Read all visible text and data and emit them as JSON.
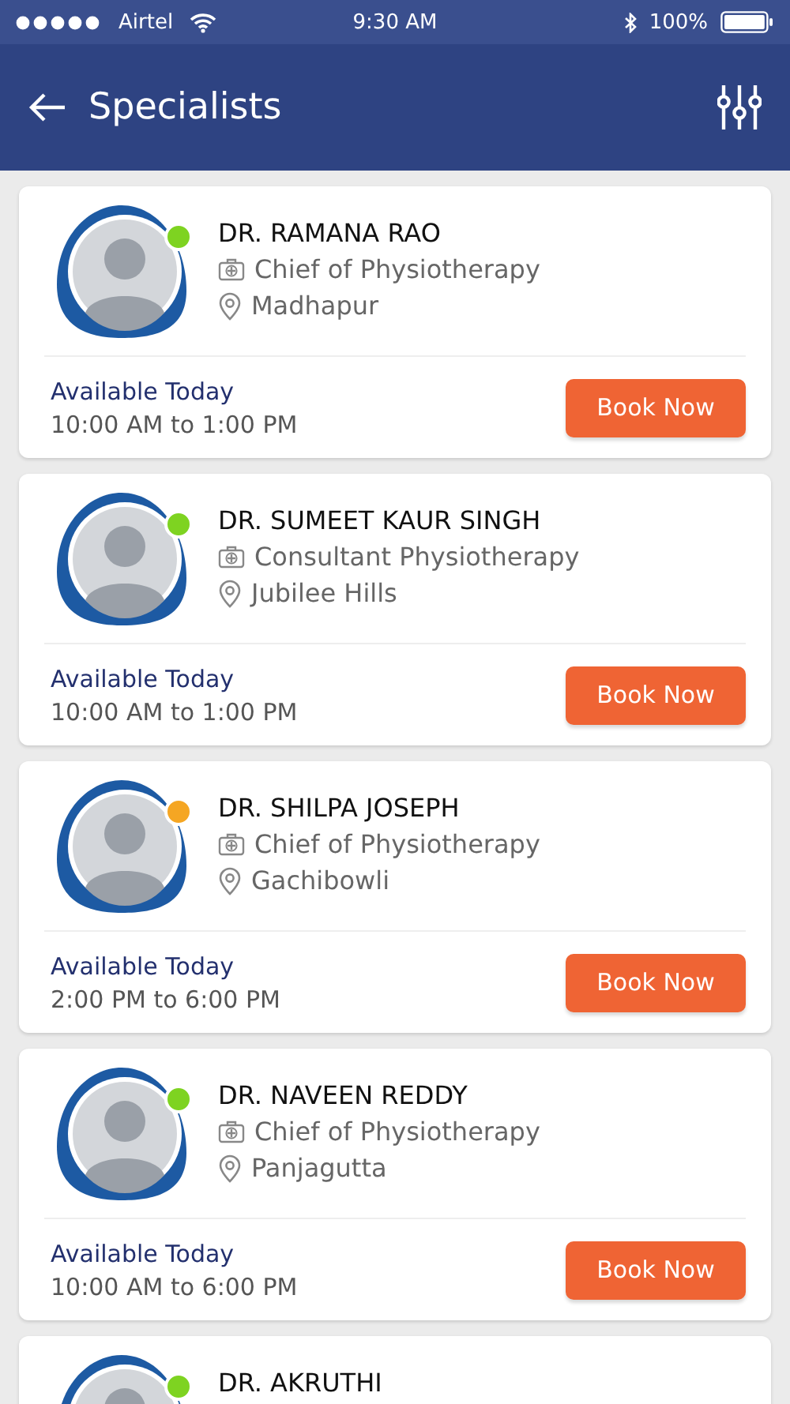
{
  "status_bar": {
    "carrier": "Airtel",
    "time": "9:30 AM",
    "battery": "100%"
  },
  "header": {
    "title": "Specialists"
  },
  "doctors": [
    {
      "name": "DR. RAMANA RAO",
      "role": "Chief of Physiotherapy",
      "location": "Madhapur",
      "availability": "Available Today",
      "hours": "10:00 AM to 1:00 PM",
      "button": "Book Now",
      "color": "#7ed321"
    },
    {
      "name": "DR. SUMEET KAUR SINGH",
      "role": "Consultant Physiotherapy",
      "location": "Jubilee Hills",
      "availability": "Available Today",
      "hours": "10:00 AM to 1:00 PM",
      "button": "Book Now",
      "color": "#7ed321"
    },
    {
      "name": "DR. SHILPA JOSEPH",
      "role": "Chief of Physiotherapy",
      "location": "Gachibowli",
      "availability": "Available Today",
      "hours": "2:00 PM to 6:00 PM",
      "button": "Book Now",
      "color": "#f5a623"
    },
    {
      "name": "DR. NAVEEN REDDY",
      "role": "Chief of Physiotherapy",
      "location": "Panjagutta",
      "availability": "Available Today",
      "hours": "10:00 AM to 6:00 PM",
      "button": "Book Now",
      "color": "#7ed321"
    },
    {
      "name": "DR. AKRUTHI",
      "color": "#7ed321"
    }
  ]
}
